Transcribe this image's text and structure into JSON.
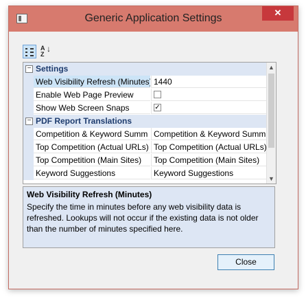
{
  "window": {
    "title": "Generic Application Settings",
    "close_glyph": "✕"
  },
  "toolbar": {
    "categorized_icon": "categorized-icon",
    "alphabetical_icon": "sort-az-icon",
    "az_top": "A",
    "az_bottom": "Z",
    "az_arrow": "↓"
  },
  "grid": {
    "categories": [
      {
        "label": "Settings",
        "toggle": "−",
        "properties": [
          {
            "name": "Web Visibility Refresh (Minutes)",
            "value": "1440",
            "selected": true
          },
          {
            "name": "Enable Web Page Preview",
            "value": "",
            "checkbox": "unchecked"
          },
          {
            "name": "Show Web Screen Snaps",
            "value": "",
            "checkbox": "checked",
            "check_glyph": "✓"
          }
        ]
      },
      {
        "label": "PDF Report Translations",
        "toggle": "−",
        "properties": [
          {
            "name": "Competition & Keyword Summ",
            "value": "Competition & Keyword Summ"
          },
          {
            "name": "Top Competition (Actual URLs)",
            "value": "Top Competition (Actual URLs)"
          },
          {
            "name": "Top Competition (Main Sites)",
            "value": "Top Competition (Main Sites)"
          },
          {
            "name": "Keyword Suggestions",
            "value": "Keyword Suggestions"
          }
        ]
      }
    ],
    "scroll_up": "▲",
    "scroll_down": "▼"
  },
  "description": {
    "title": "Web Visibility Refresh (Minutes)",
    "text": "Specify the time in minutes before any web visibility data is refreshed. Lookups will not occur if the existing data is not older than the number of minutes specified here."
  },
  "buttons": {
    "close_label": "Close"
  },
  "colors": {
    "titlebar": "#d77a6e",
    "category_bg": "#dde6f4",
    "selected_bg": "#cce4f7",
    "close_x_bg": "#c7383c"
  }
}
